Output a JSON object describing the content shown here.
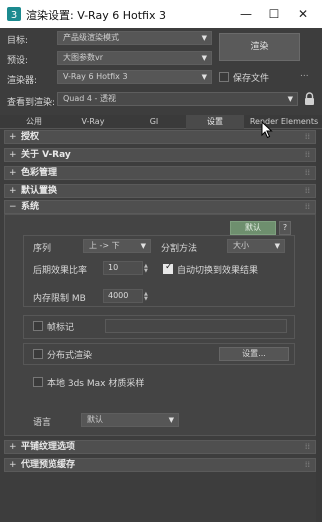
{
  "window": {
    "title": "渲染设置: V-Ray 6 Hotfix 3",
    "minimize": "—",
    "maximize": "☐",
    "close": "✕"
  },
  "top": {
    "target_label": "目标:",
    "target_value": "产品级渲染模式",
    "preset_label": "预设:",
    "preset_value": "大图参数vr",
    "renderer_label": "渲染器:",
    "renderer_value": "V-Ray 6 Hotfix 3",
    "save_file_label": "保存文件",
    "more_label": "...",
    "render_button": "渲染",
    "view_label": "查看到渲染:",
    "view_value": "Quad 4 - 透视"
  },
  "tabs": [
    "公用",
    "V-Ray",
    "GI",
    "设置",
    "Render Elements"
  ],
  "active_tab": 3,
  "rollouts_top": [
    {
      "sign": "+",
      "title": "授权"
    },
    {
      "sign": "+",
      "title": "关于 V-Ray"
    },
    {
      "sign": "+",
      "title": "色彩管理"
    },
    {
      "sign": "+",
      "title": "默认置换"
    }
  ],
  "system": {
    "sign": "−",
    "title": "系统",
    "default_button": "默认",
    "help_button": "?",
    "sequence_label": "序列",
    "sequence_value": "上 -> 下",
    "split_method_label": "分割方法",
    "split_method_value": "大小",
    "post_effect_label": "后期效果比率",
    "post_effect_value": "10",
    "auto_switch_label": "自动切换到效果结果",
    "memory_label": "内存限制 MB",
    "memory_value": "4000",
    "frame_stamp_label": "帧标记",
    "distributed_label": "分布式渲染",
    "settings_button": "设置...",
    "local_material_label": "本地 3ds Max 材质采样",
    "language_label": "语言",
    "language_value": "默认"
  },
  "rollouts_bottom": [
    {
      "sign": "+",
      "title": "平铺纹理选项"
    },
    {
      "sign": "+",
      "title": "代理预览缓存"
    }
  ],
  "grip": "⁞⁞"
}
